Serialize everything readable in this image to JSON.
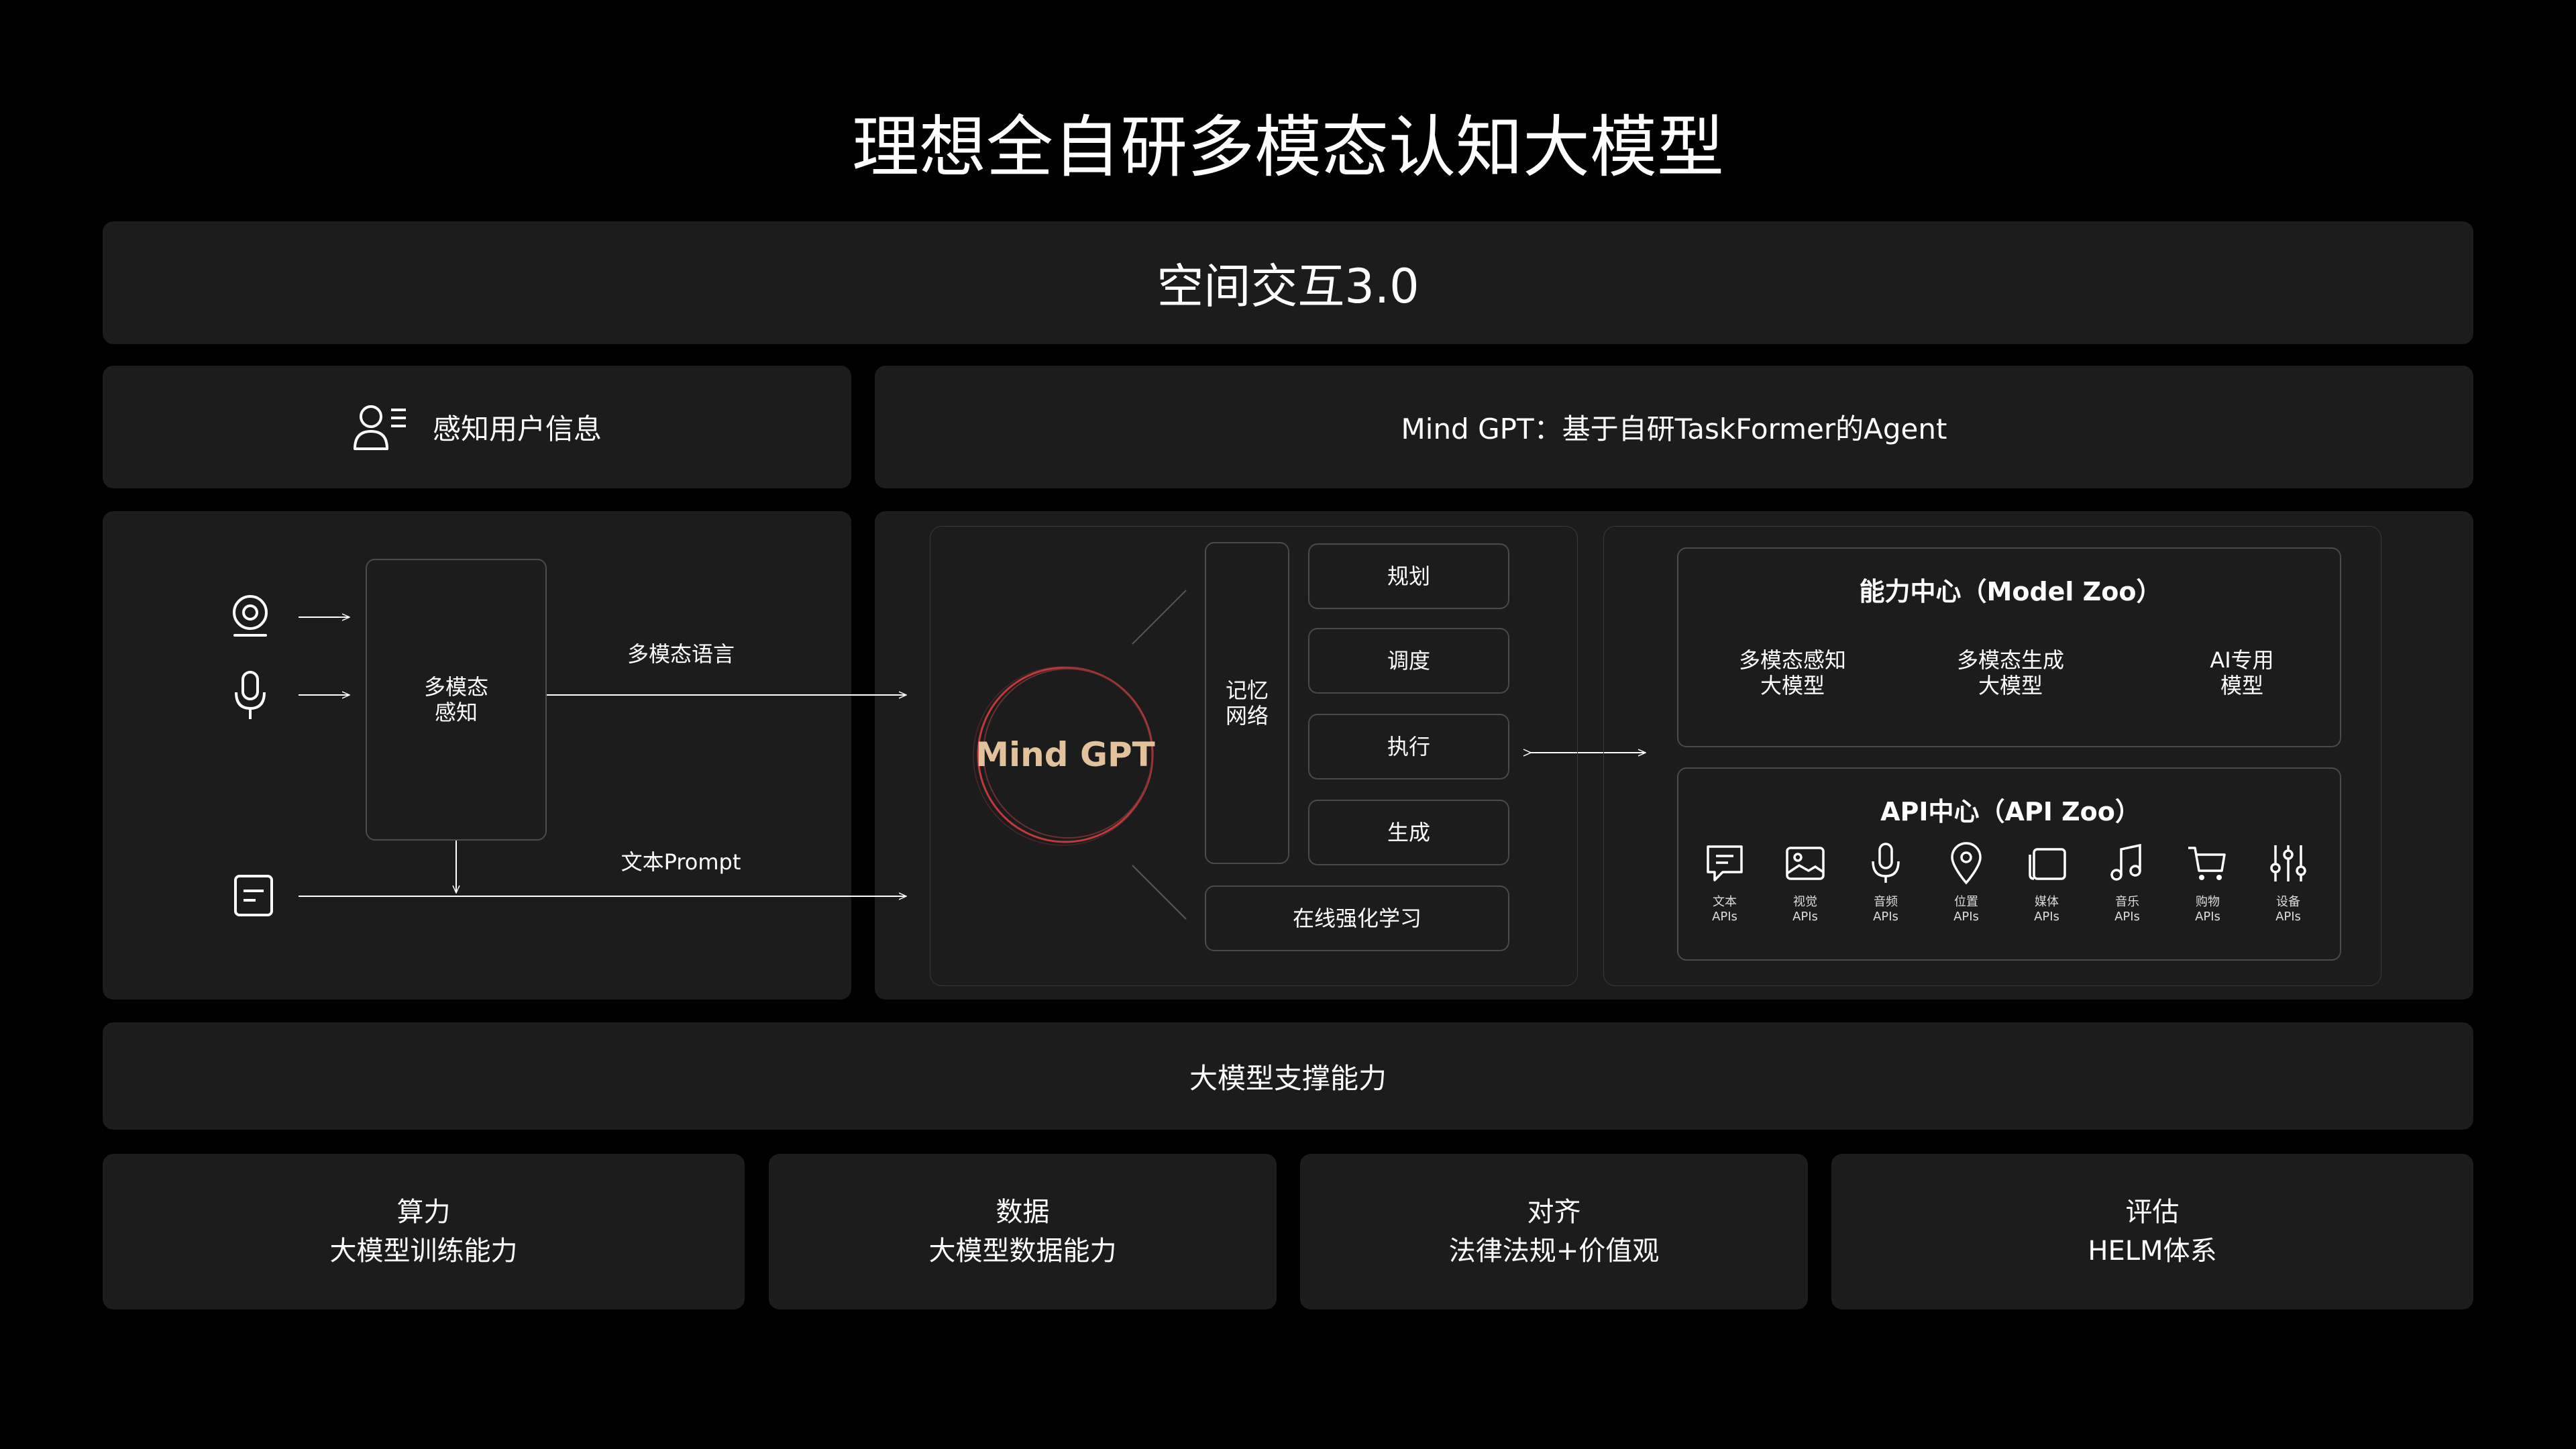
{
  "title": "理想全自研多模态认知大模型",
  "banner": "空间交互3.0",
  "perception_header": "感知用户信息",
  "agent_header": "Mind GPT：基于自研TaskFormer的Agent",
  "perception": {
    "box_label": "多模态\n感知",
    "lang_label": "多模态语言",
    "prompt_label": "文本Prompt"
  },
  "mindgpt": {
    "core_label": "Mind GPT",
    "memory_label": "记忆\n网络",
    "steps": [
      "规划",
      "调度",
      "执行",
      "生成"
    ],
    "online_rl": "在线强化学习"
  },
  "model_zoo": {
    "title": "能力中心（Model Zoo）",
    "items": [
      "多模态感知\n大模型",
      "多模态生成\n大模型",
      "AI专用\n模型"
    ]
  },
  "api_zoo": {
    "title": "API中心（API Zoo）",
    "items": [
      {
        "label": "文本\nAPIs",
        "icon": "chat-icon"
      },
      {
        "label": "视觉\nAPIs",
        "icon": "image-icon"
      },
      {
        "label": "音频\nAPIs",
        "icon": "microphone-icon"
      },
      {
        "label": "位置\nAPIs",
        "icon": "location-pin-icon"
      },
      {
        "label": "媒体\nAPIs",
        "icon": "media-icon"
      },
      {
        "label": "音乐\nAPIs",
        "icon": "music-note-icon"
      },
      {
        "label": "购物\nAPIs",
        "icon": "shopping-cart-icon"
      },
      {
        "label": "设备\nAPIs",
        "icon": "sliders-icon"
      }
    ]
  },
  "support_header": "大模型支撑能力",
  "support": [
    {
      "line1": "算力",
      "line2": "大模型训练能力"
    },
    {
      "line1": "数据",
      "line2": "大模型数据能力"
    },
    {
      "line1": "对齐",
      "line2": "法律法规+价值观"
    },
    {
      "line1": "评估",
      "line2": "HELM体系"
    }
  ],
  "colors": {
    "background": "#000000",
    "panel": "#1c1c1c",
    "mind_gpt_text": "#e1c29b",
    "mind_gpt_ring": "#c0393b"
  }
}
